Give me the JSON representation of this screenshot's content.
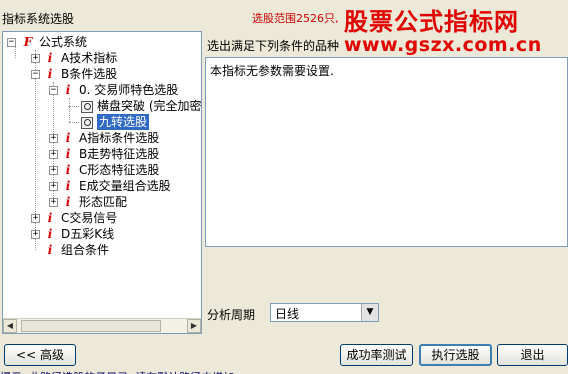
{
  "window": {
    "title": "指标系统选股",
    "range_text": "选股范围2526只,"
  },
  "watermark": {
    "line1": "股票公式指标网",
    "line2": "www.gszx.com.cn"
  },
  "tree": {
    "root": {
      "icon": "F",
      "label": "公式系统",
      "expander": "−"
    },
    "items": [
      {
        "id": "a",
        "icon": "i",
        "label": "A技术指标",
        "expander": "+"
      },
      {
        "id": "b",
        "icon": "i",
        "label": "B条件选股",
        "expander": "−"
      },
      {
        "id": "b0",
        "icon": "i",
        "label": "0. 交易师特色选股",
        "expander": "−"
      },
      {
        "id": "b0a",
        "icon": "magnifier",
        "label": "横盘突破 (完全加密"
      },
      {
        "id": "b0b",
        "icon": "magnifier",
        "label": "九转选股",
        "selected": true
      },
      {
        "id": "b1",
        "icon": "i",
        "label": "A指标条件选股",
        "expander": "+"
      },
      {
        "id": "b2",
        "icon": "i",
        "label": "B走势特征选股",
        "expander": "+"
      },
      {
        "id": "b3",
        "icon": "i",
        "label": "C形态特征选股",
        "expander": "+"
      },
      {
        "id": "b4",
        "icon": "i",
        "label": "E成交量组合选股",
        "expander": "+"
      },
      {
        "id": "b5",
        "icon": "i",
        "label": "形态匹配",
        "expander": "+"
      },
      {
        "id": "c",
        "icon": "i",
        "label": "C交易信号",
        "expander": "+"
      },
      {
        "id": "d",
        "icon": "i",
        "label": "D五彩K线",
        "expander": "+"
      },
      {
        "id": "e",
        "icon": "i",
        "label": "组合条件"
      }
    ]
  },
  "description": {
    "label": "选出满足下列条件的品种",
    "text": "本指标无参数需要设置."
  },
  "period": {
    "label": "分析周期",
    "value": "日线"
  },
  "buttons": {
    "advanced": "<< 高级",
    "success_rate": "成功率测试",
    "run": "执行选股",
    "exit": "退出"
  },
  "bottom_hint": "提示: 此路径选股的子目录, 请在默认路径中增加"
}
